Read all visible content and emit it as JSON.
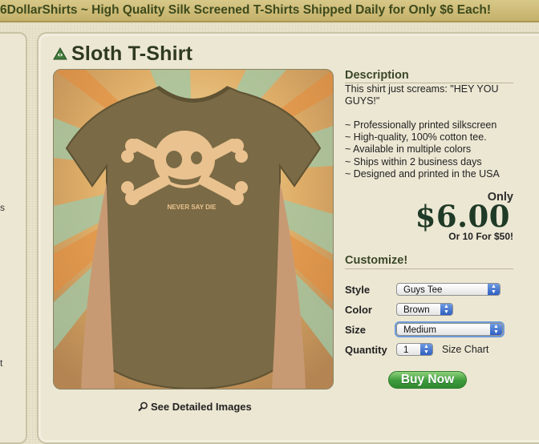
{
  "banner": {
    "text": "6DollarShirts ~ High Quality Silk Screened T-Shirts Shipped Daily for Only $6 Each!"
  },
  "left_panel": {
    "fragment_1": "s",
    "fragment_2": "t"
  },
  "product": {
    "title": "Sloth T-Shirt",
    "shirt_print_text": "NEVER SAY DIE",
    "detail_link": "See Detailed Images"
  },
  "description": {
    "heading": "Description",
    "text": "This shirt just screams: \"HEY YOU GUYS!\"",
    "features": [
      "Professionally printed silkscreen",
      "High-quality, 100% cotton tee.",
      "Available in multiple colors",
      "Ships within 2 business days",
      "Designed and printed in the USA"
    ]
  },
  "pricing": {
    "only": "Only",
    "price": "$6.00",
    "bulk": "Or 10 For $50!"
  },
  "customize": {
    "heading": "Customize!",
    "style_label": "Style",
    "style_value": "Guys Tee",
    "color_label": "Color",
    "color_value": "Brown",
    "size_label": "Size",
    "size_value": "Medium",
    "quantity_label": "Quantity",
    "quantity_value": "1",
    "size_chart": "Size Chart"
  },
  "buy_button": "Buy Now",
  "colors": {
    "banner_text": "#3d4a1c",
    "shirt": "#7a6a45",
    "price": "#1f3a26",
    "buy": "#3c9a3c"
  }
}
